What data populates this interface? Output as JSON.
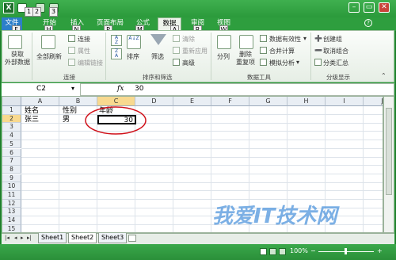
{
  "qat": {
    "keys": [
      "1",
      "2",
      "3"
    ]
  },
  "tabs": [
    {
      "label": "文件",
      "key": "F"
    },
    {
      "label": "开始",
      "key": "H"
    },
    {
      "label": "插入",
      "key": "N"
    },
    {
      "label": "页面布局",
      "key": "P"
    },
    {
      "label": "公式",
      "key": "M"
    },
    {
      "label": "数据",
      "key": "A"
    },
    {
      "label": "审阅",
      "key": "R"
    },
    {
      "label": "视图",
      "key": "W"
    }
  ],
  "ribbon": {
    "get_external": "获取\n外部数据",
    "refresh_all": "全部刷新",
    "connections": "连接",
    "properties": "属性",
    "edit_links": "编辑链接",
    "group_connections": "连接",
    "sort_az": "A↓Z",
    "sort": "排序",
    "filter": "筛选",
    "clear": "清除",
    "reapply": "重新应用",
    "advanced": "高级",
    "group_sort": "排序和筛选",
    "text_to_columns": "分列",
    "remove_dup": "删除\n重复项",
    "data_validation": "数据有效性",
    "consolidate": "合并计算",
    "what_if": "模拟分析",
    "group_tools": "数据工具",
    "group_outline_btn": "创建组",
    "ungroup": "取消组合",
    "subtotal": "分类汇总",
    "group_outline": "分级显示"
  },
  "formula": {
    "name_box": "C2",
    "fx": "fx",
    "value": "30"
  },
  "columns": [
    "A",
    "B",
    "C",
    "D",
    "E",
    "F",
    "G",
    "H",
    "I",
    "J"
  ],
  "rows": [
    "1",
    "2",
    "3",
    "4",
    "5",
    "6",
    "7",
    "8",
    "9",
    "10",
    "11",
    "12",
    "13",
    "14",
    "15"
  ],
  "cells": {
    "A1": "姓名",
    "B1": "性别",
    "C1": "年龄",
    "A2": "张三",
    "B2": "男",
    "C2": "30"
  },
  "sheets": [
    "Sheet1",
    "Sheet2",
    "Sheet3"
  ],
  "status": {
    "zoom": "100%"
  },
  "watermark": "我爱IT技术网",
  "accent": "#2e9e3e",
  "file_tab_color": "#2c7fc9",
  "annotation_color": "#d0121b"
}
